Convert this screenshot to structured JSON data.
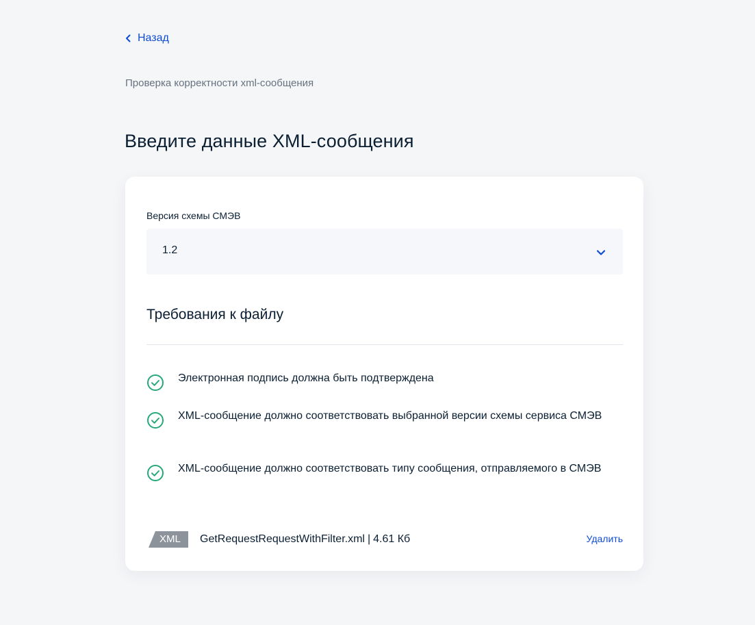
{
  "nav": {
    "back_label": "Назад"
  },
  "breadcrumb": "Проверка корректности xml-сообщения",
  "page_title": "Введите данные XML-сообщения",
  "form": {
    "schema_label": "Версия схемы СМЭВ",
    "schema_value": "1.2",
    "requirements_title": "Требования к файлу",
    "requirements": [
      {
        "text": "Электронная подпись должна быть подтверждена",
        "icon": "check-circle-icon"
      },
      {
        "text": "XML-сообщение должно соответствовать выбранной версии схемы сервиса СМЭВ",
        "icon": "check-circle-icon"
      },
      {
        "text": "XML-сообщение должно соответствовать типу сообщения, отправляемого в СМЭВ",
        "icon": "check-circle-icon"
      }
    ]
  },
  "file": {
    "badge": "XML",
    "name": "GetRequestRequestWithFilter.xml",
    "separator": "|",
    "size": "4.61 Кб",
    "delete_label": "Удалить"
  },
  "colors": {
    "accent": "#0d4cd3",
    "success": "#28a778",
    "badge": "#8d939b",
    "background": "#f5f6f8",
    "text": "#0b1f33"
  }
}
